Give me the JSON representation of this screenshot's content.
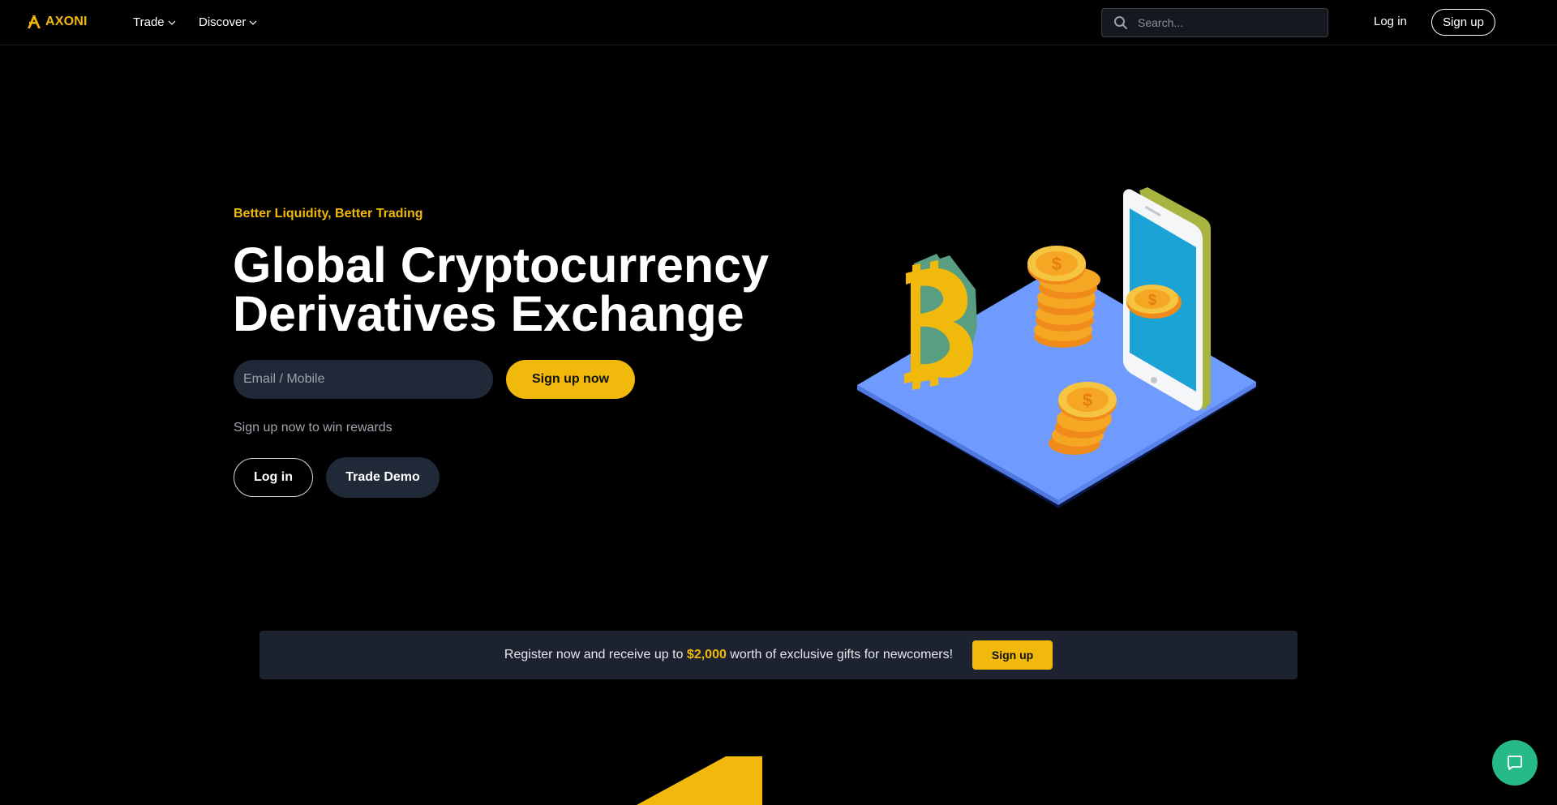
{
  "brand": {
    "name": "AXONI",
    "accent": "#f0b90b"
  },
  "nav": {
    "items": [
      {
        "label": "Trade",
        "icon": "chevron-down-icon"
      },
      {
        "label": "Discover",
        "icon": "chevron-down-icon"
      }
    ],
    "search_placeholder": "Search...",
    "login_label": "Log in",
    "signup_label": "Sign up"
  },
  "hero": {
    "tagline": "Better Liquidity, Better Trading",
    "title_line1": "Global Cryptocurrency",
    "title_line2": "Derivatives Exchange",
    "email_placeholder": "Email / Mobile",
    "signup_now_label": "Sign up now",
    "rewards_text": "Sign up now to win rewards",
    "login_label": "Log in",
    "trade_demo_label": "Trade Demo",
    "illustration_icon": "crypto-isometric-illustration"
  },
  "banner": {
    "text_before": "Register now and receive up to ",
    "amount": "$2,000",
    "text_after": " worth of exclusive gifts for newcomers!",
    "button_label": "Sign up"
  },
  "chat": {
    "icon": "chat-icon",
    "color": "#26b98a"
  }
}
